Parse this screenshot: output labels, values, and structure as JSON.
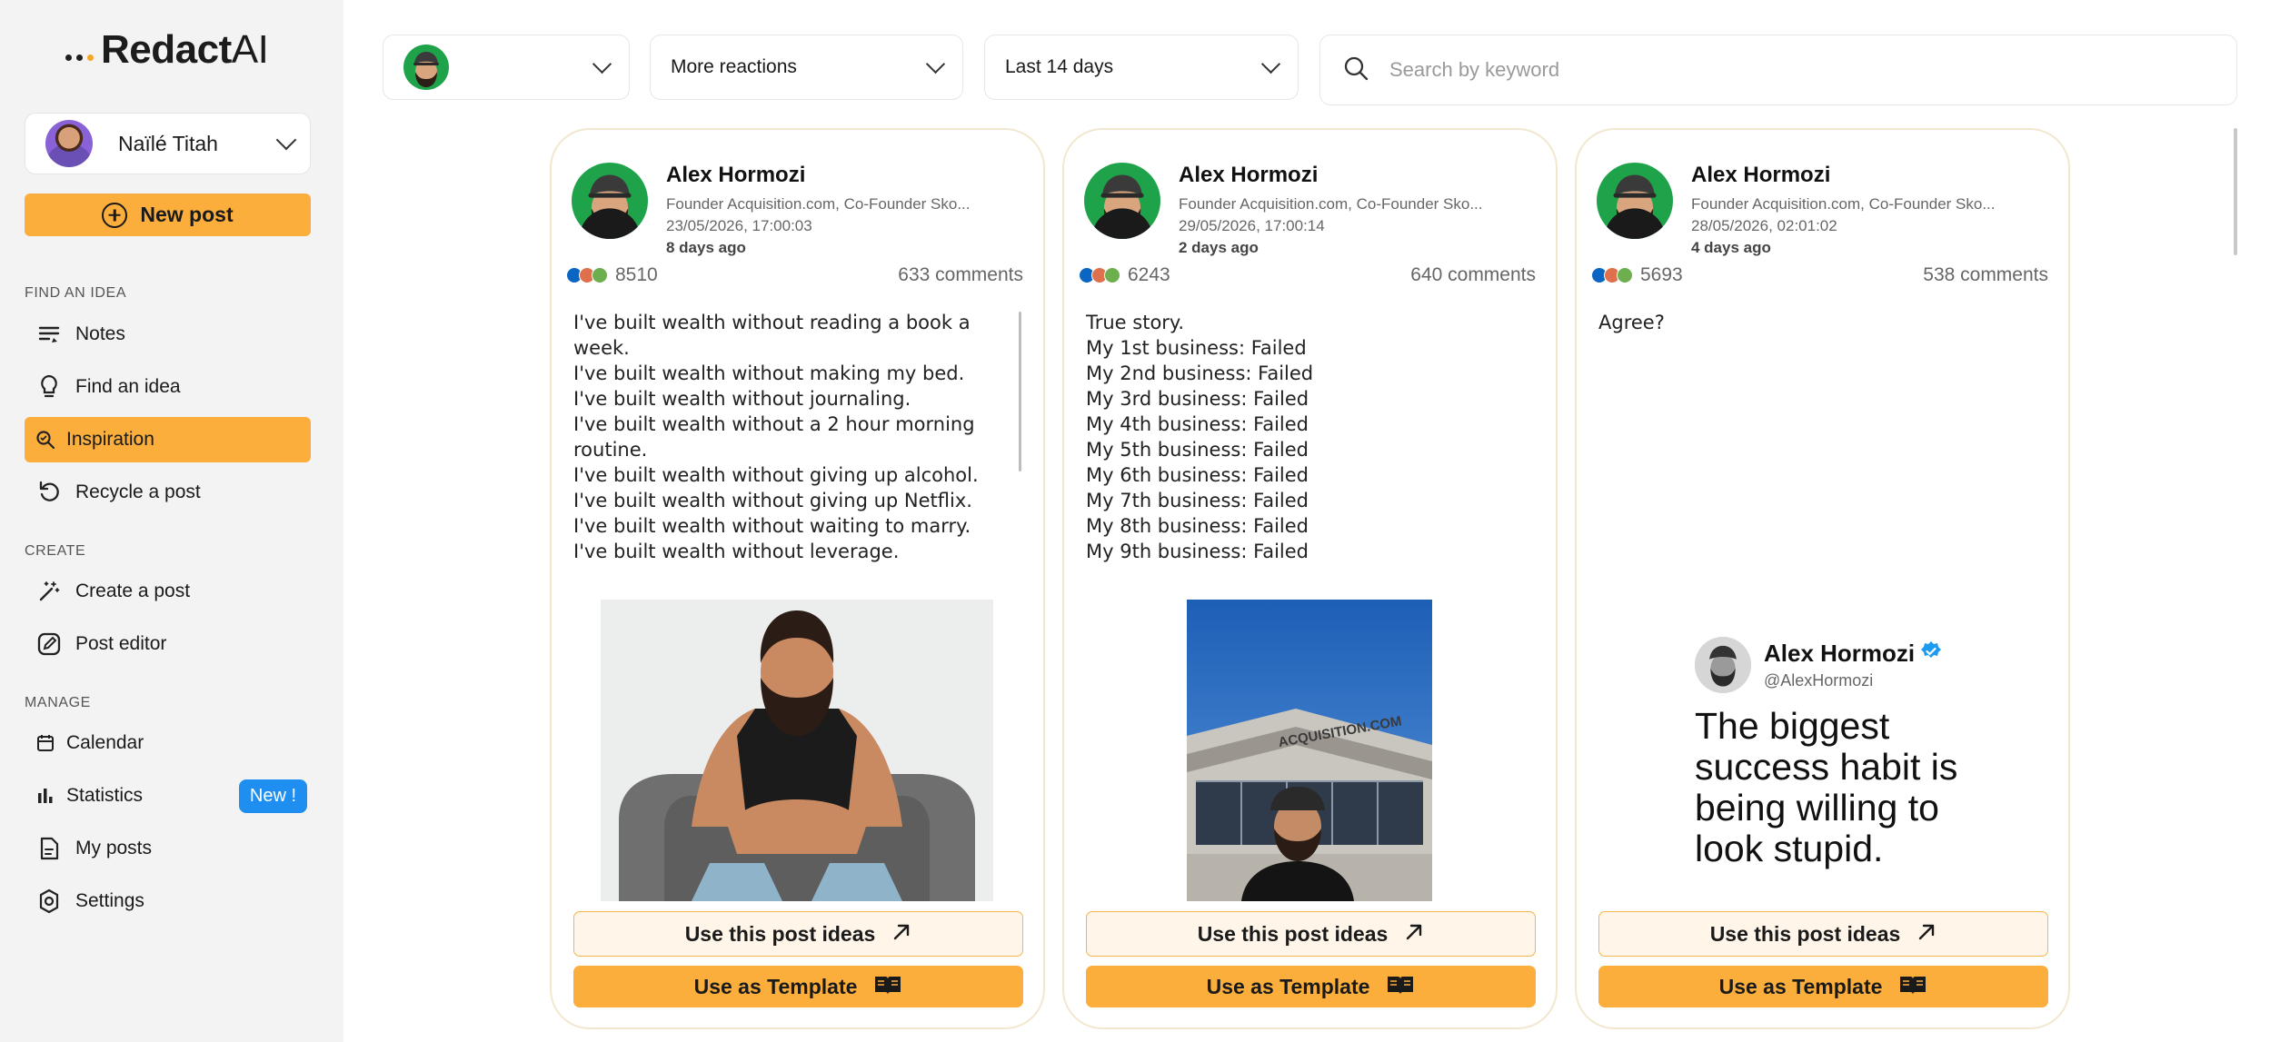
{
  "app": {
    "logo": "RedactAI",
    "logo_main": "Redact",
    "logo_ai": "AI"
  },
  "user": {
    "name": "Naïlé Titah"
  },
  "new_post_label": "New post",
  "sidebar": {
    "sections": [
      {
        "title": "FIND AN IDEA"
      },
      {
        "title": "CREATE"
      },
      {
        "title": "MANAGE"
      }
    ],
    "items": [
      {
        "label": "Notes",
        "icon": "notes-icon"
      },
      {
        "label": "Find an idea",
        "icon": "lightbulb-icon"
      },
      {
        "label": "Inspiration",
        "icon": "inspiration-icon",
        "active": true
      },
      {
        "label": "Recycle a post",
        "icon": "recycle-icon"
      },
      {
        "label": "Create a post",
        "icon": "magic-wand-icon"
      },
      {
        "label": "Post editor",
        "icon": "edit-icon"
      },
      {
        "label": "Calendar",
        "icon": "calendar-icon"
      },
      {
        "label": "Statistics",
        "icon": "bar-chart-icon",
        "badge": "New !"
      },
      {
        "label": "My posts",
        "icon": "document-icon"
      },
      {
        "label": "Settings",
        "icon": "gear-icon"
      }
    ]
  },
  "filters": {
    "reactions": "More reactions",
    "period": "Last 14 days",
    "search_placeholder": "Search by keyword"
  },
  "posts": [
    {
      "author": "Alex Hormozi",
      "headline": "Founder Acquisition.com, Co-Founder Sko...",
      "date": "23/05/2026, 17:00:03",
      "ago": "8 days ago",
      "reactions": "8510",
      "comments": "633 comments",
      "text": "I've built wealth without reading a book a week.\nI've built wealth without making my bed.\nI've built wealth without journaling.\nI've built wealth without a 2 hour morning routine.\nI've built wealth without giving up alcohol.\nI've built wealth without giving up Netflix.\nI've built wealth without waiting to marry.\nI've built wealth without leverage.\n\nBut not without showing up, day-in, day-out, doing the work."
    },
    {
      "author": "Alex Hormozi",
      "headline": "Founder Acquisition.com, Co-Founder Sko...",
      "date": "29/05/2026, 17:00:14",
      "ago": "2 days ago",
      "reactions": "6243",
      "comments": "640 comments",
      "text": "True story.\nMy 1st business: Failed\nMy 2nd business: Failed\nMy 3rd business: Failed\nMy 4th business: Failed\nMy 5th business: Failed\nMy 6th business: Failed\nMy 7th business: Failed\nMy 8th business: Failed\nMy 9th business: Failed\n\nEach one taught me something different."
    },
    {
      "author": "Alex Hormozi",
      "headline": "Founder Acquisition.com, Co-Founder Sko...",
      "date": "28/05/2026, 02:01:02",
      "ago": "4 days ago",
      "reactions": "5693",
      "comments": "538 comments",
      "text": "Agree?",
      "tweet": {
        "name": "Alex Hormozi",
        "handle": "@AlexHormozi",
        "text": "The biggest success habit is being willing to look stupid."
      }
    }
  ],
  "buttons": {
    "ideas": "Use this post ideas",
    "template": "Use as Template"
  },
  "building_sign": "ACQUISITION.COM",
  "colors": {
    "accent": "#fbae3c",
    "badge": "#1f8ef1",
    "avatar_bg": "#1fa34a",
    "verified": "#1d9bf0"
  }
}
